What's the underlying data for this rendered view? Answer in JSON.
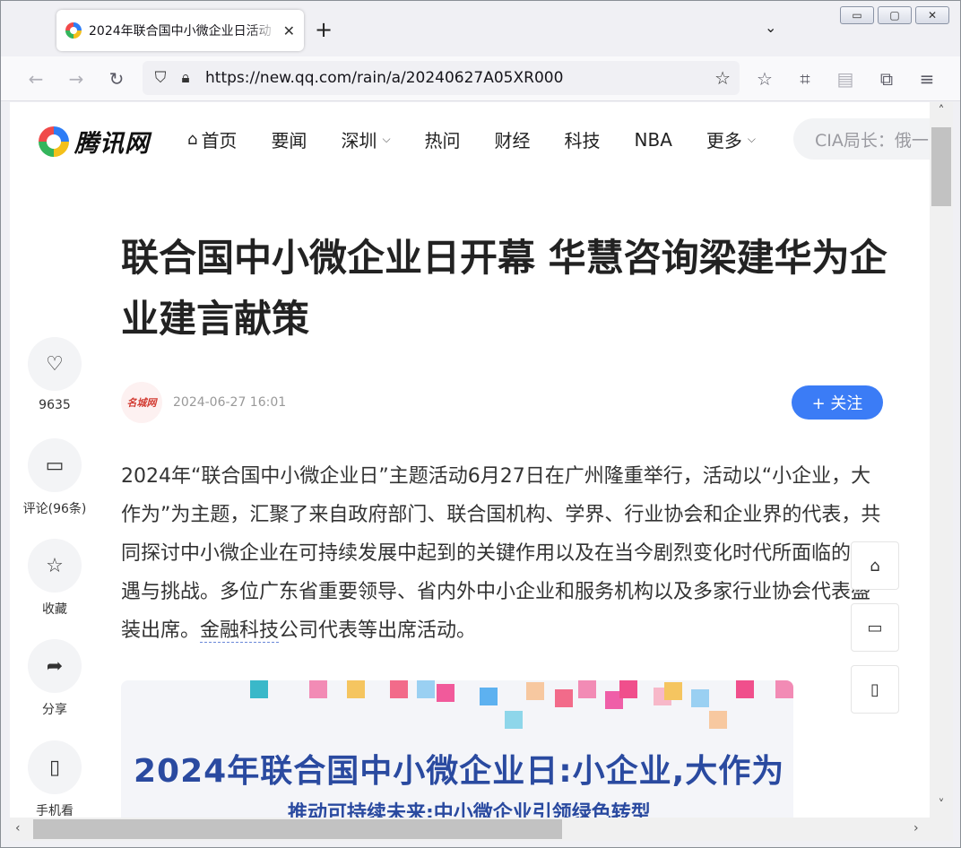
{
  "browser": {
    "tab_title": "2024年联合国中小微企业日活动",
    "tab_close": "✕",
    "new_tab": "+",
    "tabs_list": "⌄",
    "url": "https://new.qq.com/rain/a/20240627A05XR000",
    "window_buttons": {
      "minimize": "▭",
      "maximize": "▢",
      "close": "✕"
    },
    "icons": {
      "back": "←",
      "forward": "→",
      "reload": "↻",
      "shield": "⛉",
      "lock": "🔒︎",
      "star": "☆",
      "pocket": "☆",
      "crop": "⌗",
      "reader": "▤",
      "extensions": "⧉",
      "menu": "≡"
    }
  },
  "site": {
    "logo_text": "腾讯网",
    "nav": [
      {
        "label": "首页",
        "icon": "⌂",
        "dropdown": false
      },
      {
        "label": "要闻",
        "dropdown": false
      },
      {
        "label": "深圳",
        "dropdown": true
      },
      {
        "label": "热问",
        "dropdown": false
      },
      {
        "label": "财经",
        "dropdown": false
      },
      {
        "label": "科技",
        "dropdown": false
      },
      {
        "label": "NBA",
        "dropdown": false
      },
      {
        "label": "更多",
        "dropdown": true
      }
    ],
    "chevron": "⌵",
    "search_placeholder": "CIA局长：俄一"
  },
  "article": {
    "title": "联合国中小微企业日开幕 华慧咨询梁建华为企业建言献策",
    "source_logo_text": "名城网",
    "time": "2024-06-27 16:01",
    "follow_label": "+ 关注",
    "body_before_link": "2024年“联合国中小微企业日”主题活动6月27日在广州隆重举行，活动以“小企业，大作为”为主题，汇聚了来自政府部门、联合国机构、学界、行业协会和企业界的代表，共同探讨中小微企业在可持续发展中起到的关键作用以及在当今剧烈变化时代所面临的机遇与挑战。多位广东省重要领导、省内外中小企业和服务机构以及多家行业协会代表盛装出席。",
    "body_link": "金融科技",
    "body_after_link": "公司代表等出席活动。",
    "image_title": "2024年联合国中小微企业日:小企业,大作为",
    "image_subtitle": "推动可持续未来:中小微企业引领绿色转型"
  },
  "rail": [
    {
      "icon": "♡",
      "label": "9635"
    },
    {
      "icon": "▭",
      "label": "评论(96条)"
    },
    {
      "icon": "☆",
      "label": "收藏"
    },
    {
      "icon": "➦",
      "label": "分享"
    },
    {
      "icon": "▯",
      "label": "手机看"
    }
  ],
  "float_tools": {
    "home": "⌂",
    "comment": "▭",
    "mobile": "▯"
  },
  "scroll": {
    "up": "˄",
    "down": "˅",
    "left": "‹",
    "right": "›"
  },
  "colors": {
    "accent": "#3b7cf6",
    "image_text": "#2a4aa0"
  }
}
